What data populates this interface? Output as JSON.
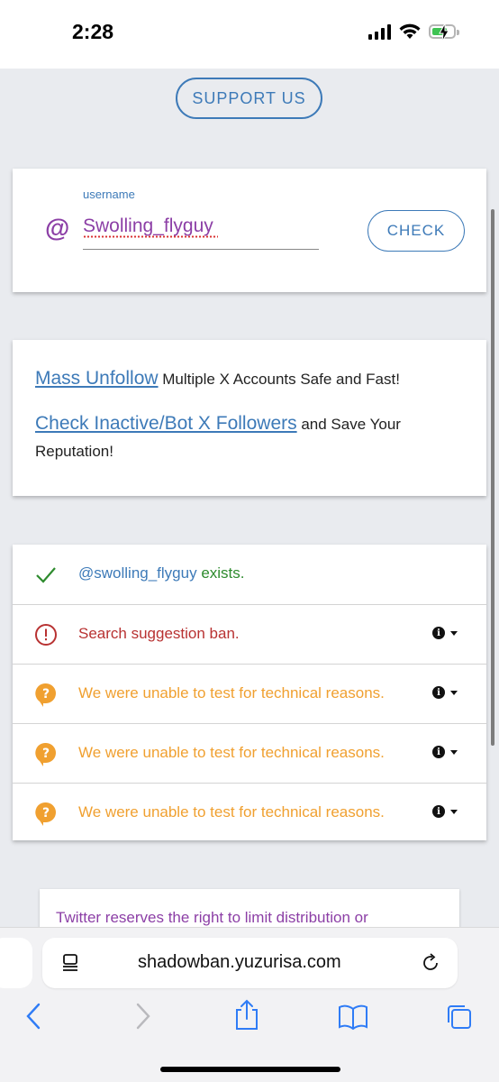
{
  "status": {
    "time": "2:28"
  },
  "support_label": "SUPPORT US",
  "form": {
    "label": "username",
    "at": "@",
    "value": "Swolling_flyguy",
    "check_label": "CHECK"
  },
  "promo": {
    "link1": "Mass Unfollow",
    "text1": " Multiple X Accounts Safe and Fast!",
    "link2": "Check Inactive/Bot X Followers",
    "text2": " and Save Your Reputation!"
  },
  "results": {
    "exists_handle": "@swolling_flyguy",
    "exists_text": " exists.",
    "search_ban": "Search suggestion ban.",
    "unable_1": "We were unable to test for technical reasons.",
    "unable_2": "We were unable to test for technical reasons.",
    "unable_3": "We were unable to test for technical reasons."
  },
  "notice": "Twitter reserves the right to limit distribution or",
  "browser": {
    "url": "shadowban.yuzurisa.com"
  },
  "colors": {
    "accent_blue": "#3d7ab8",
    "purple": "#8c3fa6",
    "success_green": "#2e8b2e",
    "error_red": "#b83232",
    "warning_orange": "#f0a030"
  }
}
